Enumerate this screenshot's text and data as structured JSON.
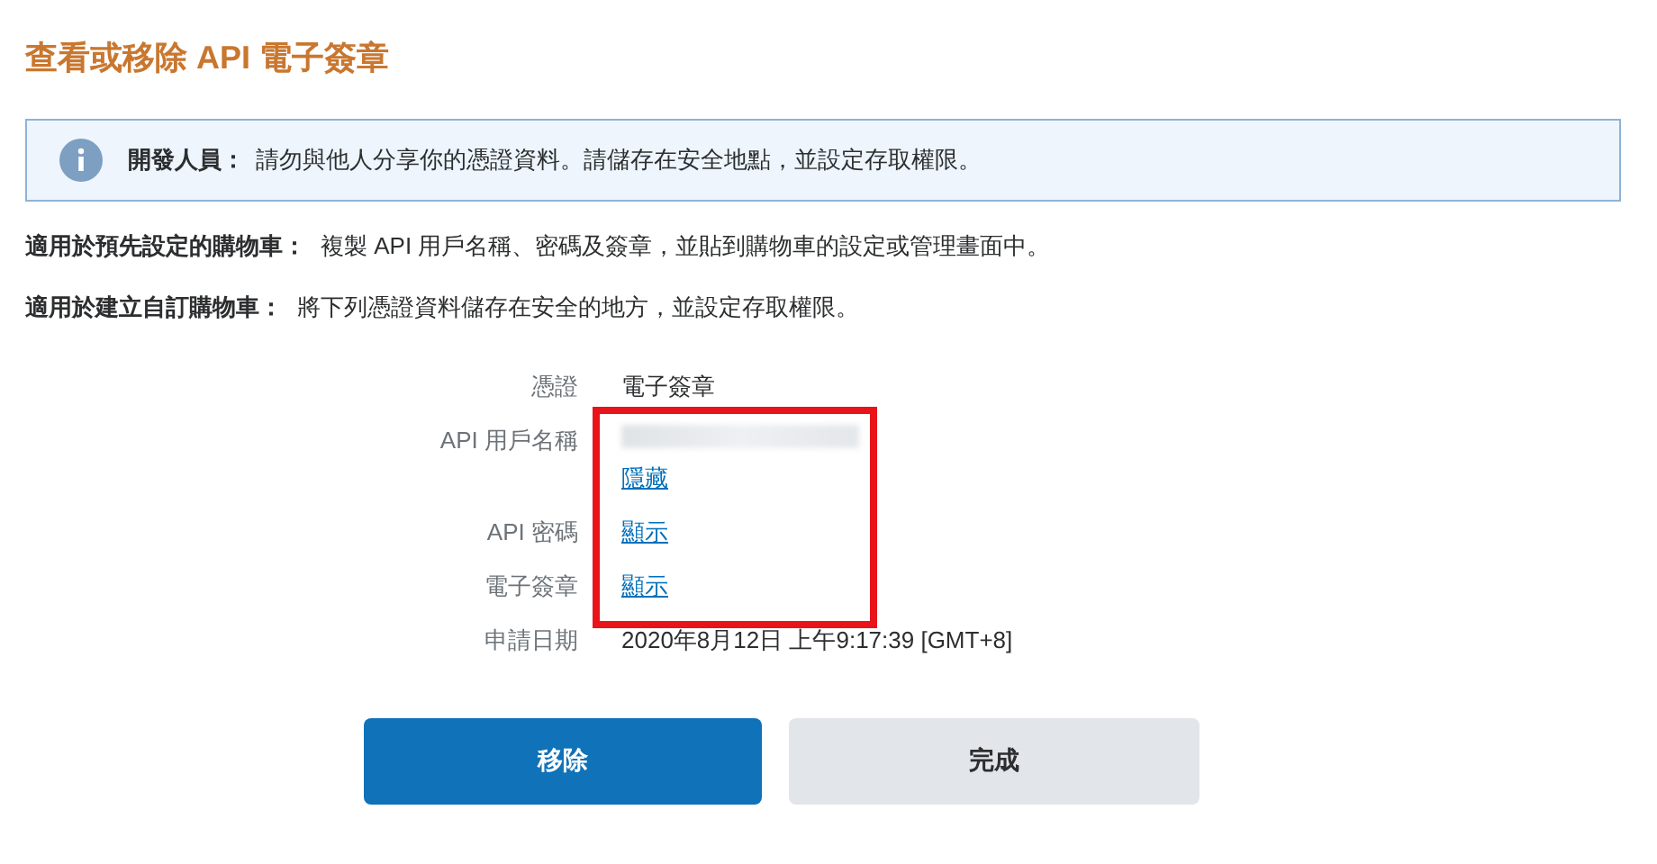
{
  "title": "查看或移除 API 電子簽章",
  "notice": {
    "kind": "info",
    "label": "開發人員：",
    "text": "請勿與他人分享你的憑證資料。請儲存在安全地點，並設定存取權限。"
  },
  "instructions": [
    {
      "label": "適用於預先設定的購物車：",
      "text": "複製 API 用戶名稱、密碼及簽章，並貼到購物車的設定或管理畫面中。"
    },
    {
      "label": "適用於建立自訂購物車：",
      "text": "將下列憑證資料儲存在安全的地方，並設定存取權限。"
    }
  ],
  "fields": [
    {
      "label": "憑證",
      "kind": "text",
      "value": "電子簽章",
      "highlighted": false
    },
    {
      "label": "API 用戶名稱",
      "kind": "redacted",
      "link": "隱藏",
      "highlighted": true
    },
    {
      "label": "API 密碼",
      "kind": "link",
      "link": "顯示",
      "highlighted": true
    },
    {
      "label": "電子簽章",
      "kind": "link",
      "link": "顯示",
      "highlighted": true
    },
    {
      "label": "申請日期",
      "kind": "text",
      "value": "2020年8月12日 上午9:17:39 [GMT+8]",
      "highlighted": false
    }
  ],
  "buttons": [
    {
      "label": "移除",
      "kind": "primary"
    },
    {
      "label": "完成",
      "kind": "secondary"
    }
  ]
}
